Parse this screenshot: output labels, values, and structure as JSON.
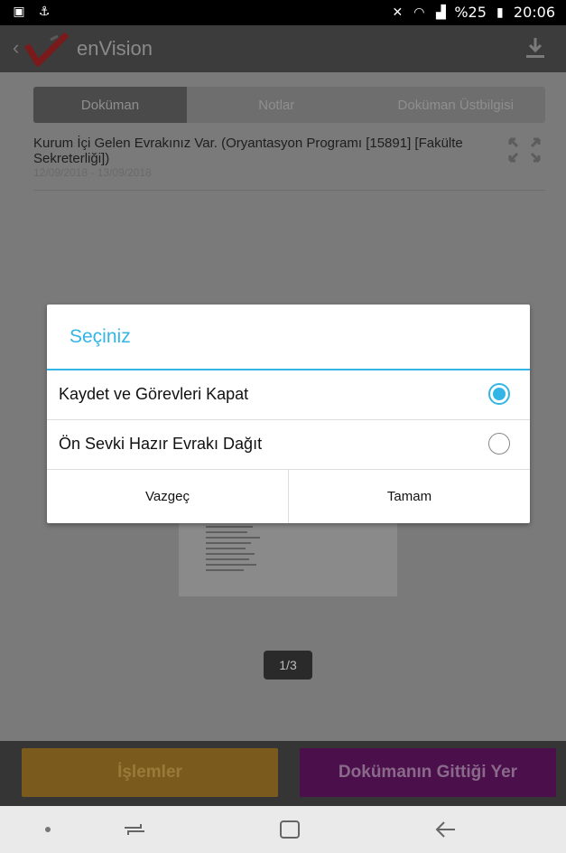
{
  "status_bar": {
    "battery_percent": "%25",
    "time": "20:06",
    "icons": [
      "image-icon",
      "usb-icon",
      "mute-icon",
      "wifi-icon",
      "signal-icon",
      "battery-icon"
    ]
  },
  "app_bar": {
    "title": "enVision",
    "icons": [
      "back-icon",
      "envision-logo",
      "download-icon"
    ]
  },
  "tabs": [
    {
      "label": "Doküman",
      "active": true
    },
    {
      "label": "Notlar",
      "active": false
    },
    {
      "label": "Doküman Üstbilgisi",
      "active": false
    }
  ],
  "document": {
    "title": "Kurum İçi Gelen Evrakınız Var. (Oryantasyon Programı [15891] [Fakülte Sekreterliği])",
    "date_range": "12/09/2018 - 13/09/2018"
  },
  "pager": {
    "label": "1/3"
  },
  "bottom_buttons": {
    "islemler": "İşlemler",
    "gittigi_yer": "Dokümanın Gittiği Yer"
  },
  "dialog": {
    "title": "Seçiniz",
    "options": [
      {
        "label": "Kaydet ve Görevleri Kapat",
        "selected": true
      },
      {
        "label": "Ön Sevki Hazır Evrakı Dağıt",
        "selected": false
      }
    ],
    "cancel_label": "Vazgeç",
    "ok_label": "Tamam"
  },
  "colors": {
    "accent": "#33b5e5",
    "islemler_bg": "#7b5a1e",
    "gittigi_bg": "#4b0f4b"
  }
}
